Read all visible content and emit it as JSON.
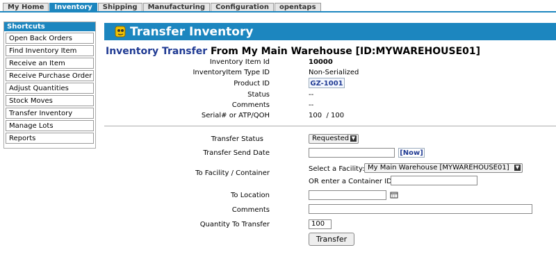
{
  "tabs": [
    "My Home",
    "Inventory",
    "Shipping",
    "Manufacturing",
    "Configuration",
    "opentaps"
  ],
  "active_tab": "Inventory",
  "sidebar": {
    "title": "Shortcuts",
    "items": [
      "Open Back Orders",
      "Find Inventory Item",
      "Receive an Item",
      "Receive Purchase Order",
      "Adjust Quantities",
      "Stock Moves",
      "Transfer Inventory",
      "Manage Lots",
      "Reports"
    ]
  },
  "page_title": "Transfer Inventory",
  "subtitle": {
    "accent": "Inventory Transfer",
    "rest": "From My Main Warehouse [ID:MYWAREHOUSE01]"
  },
  "details": {
    "item_id_label": "Inventory Item Id",
    "item_id": "10000",
    "type_label": "InventoryItem Type ID",
    "type": "Non-Serialized",
    "product_label": "Product ID",
    "product": "GZ-1001",
    "status_label": "Status",
    "status": "--",
    "comments_label": "Comments",
    "comments": "--",
    "serial_label": "Serial# or ATP/QOH",
    "serial": "100  / 100"
  },
  "form": {
    "transfer_status_label": "Transfer Status",
    "transfer_status": "Requested",
    "send_date_label": "Transfer Send Date",
    "send_date": "",
    "now_link": "[Now]",
    "to_facility_label": "To Facility / Container",
    "select_facility_label": "Select a Facility:",
    "facility": "My Main Warehouse [MYWAREHOUSE01]",
    "container_label": "OR enter a Container ID:",
    "container": "",
    "to_location_label": "To Location",
    "to_location": "",
    "comments_label": "Comments",
    "comments": "",
    "quantity_label": "Quantity To Transfer",
    "quantity": "100",
    "submit": "Transfer"
  }
}
